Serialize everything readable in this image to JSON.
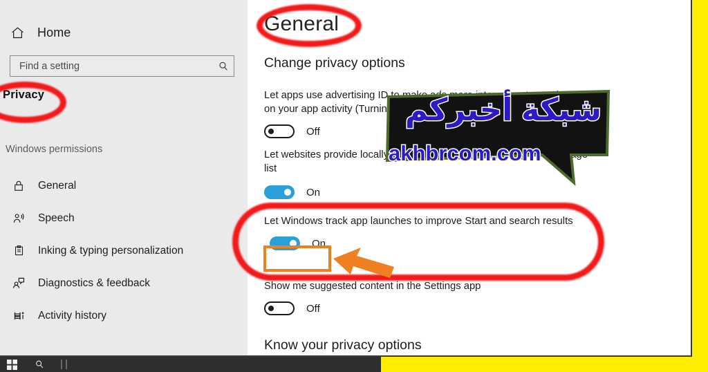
{
  "window": {
    "accent_yellow": "#ffed00",
    "annotation_red": "#f21a1a",
    "annotation_orange": "#ef8021",
    "toggle_on_color": "#2b9fd8"
  },
  "sidebar": {
    "home": {
      "label": "Home",
      "icon": "home-icon"
    },
    "search": {
      "placeholder": "Find a setting",
      "value": "",
      "icon": "search-icon"
    },
    "section_title": "Privacy",
    "group_header": "Windows permissions",
    "items": [
      {
        "label": "General",
        "icon": "lock-icon"
      },
      {
        "label": "Speech",
        "icon": "person-speaking-icon"
      },
      {
        "label": "Inking & typing personalization",
        "icon": "clipboard-icon"
      },
      {
        "label": "Diagnostics & feedback",
        "icon": "person-feedback-icon"
      },
      {
        "label": "Activity history",
        "icon": "timeline-icon"
      }
    ]
  },
  "content": {
    "page_title": "General",
    "section_heading": "Change privacy options",
    "settings": [
      {
        "description": "Let apps use advertising ID to make ads more interesting to you based on your app activity (Turning this off will reset your ID.)",
        "state_label": "Off",
        "state": "off"
      },
      {
        "description": "Let websites provide locally relevant content by accessing my language list",
        "state_label": "On",
        "state": "on"
      },
      {
        "description": "Let Windows track app launches to improve Start and search results",
        "state_label": "On",
        "state": "on"
      },
      {
        "description": "Show me suggested content in the Settings app",
        "state_label": "Off",
        "state": "off"
      }
    ],
    "footer_heading": "Know your privacy options"
  },
  "watermark": {
    "arabic": "شبكة أخبركم",
    "domain": "akhbrcom.com"
  },
  "taskbar": {
    "start": "start-button",
    "search": "search-button"
  }
}
